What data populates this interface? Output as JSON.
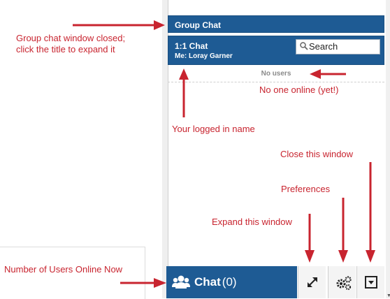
{
  "group_chat": {
    "title": "Group Chat"
  },
  "one_chat": {
    "title": "1:1 Chat",
    "me_label": "Me: Loray Garner"
  },
  "search": {
    "label": "Search"
  },
  "users": {
    "empty_label": "No users"
  },
  "bottom_bar": {
    "chat_label": "Chat",
    "count": "(0)"
  },
  "annotations": {
    "group_closed": "Group chat window closed;\nclick the title to expand it",
    "no_one_online": "No one online (yet!)",
    "logged_name": "Your logged in name",
    "close_window": "Close this window",
    "preferences": "Preferences",
    "expand_window": "Expand this window",
    "users_online": "Number of Users Online Now"
  },
  "colors": {
    "accent": "#1e5b94",
    "annotation": "#c8242f"
  },
  "icons": [
    "search-icon",
    "users-icon",
    "expand-icon",
    "gears-icon",
    "collapse-icon"
  ]
}
